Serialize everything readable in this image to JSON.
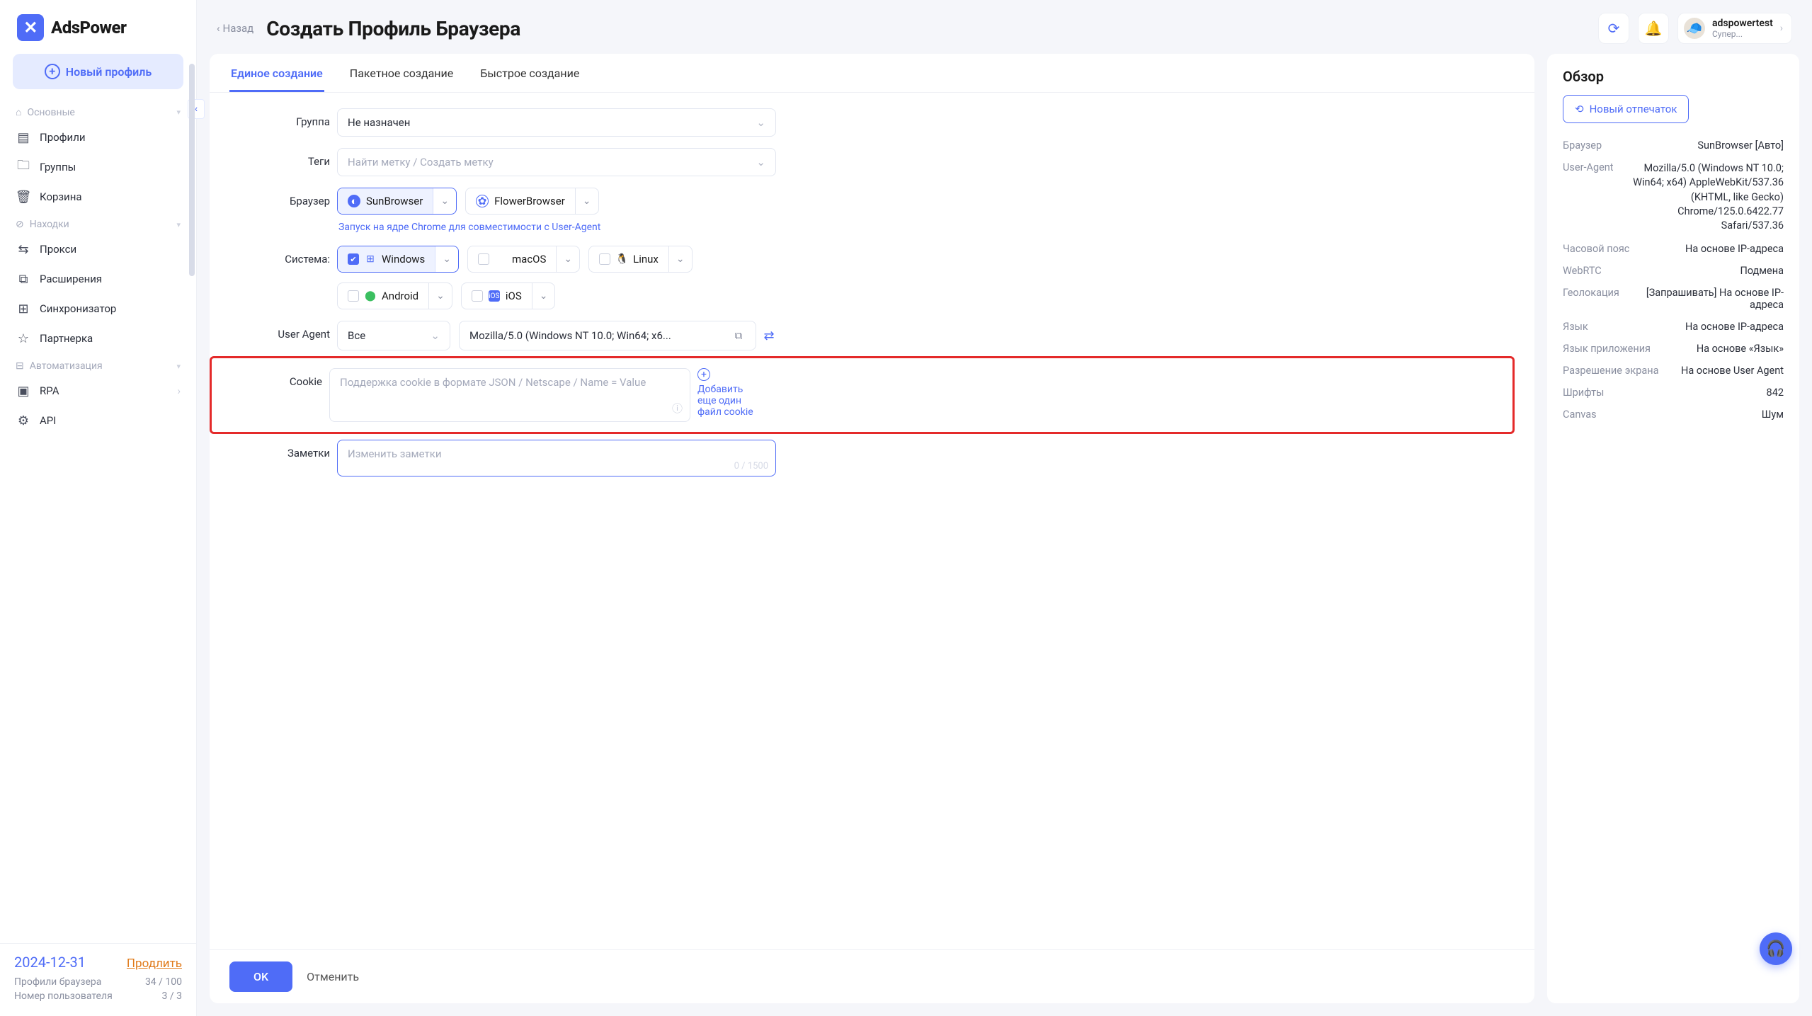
{
  "brand": "AdsPower",
  "sidebar": {
    "new_profile": "Новый профиль",
    "sections": {
      "main": "Основные",
      "findings": "Находки",
      "automation": "Автоматизация"
    },
    "items": {
      "profiles": "Профили",
      "groups": "Группы",
      "trash": "Корзина",
      "proxy": "Прокси",
      "extensions": "Расширения",
      "sync": "Синхронизатор",
      "affiliate": "Партнерка",
      "rpa": "RPA",
      "api": "API"
    },
    "footer": {
      "date": "2024-12-31",
      "extend": "Продлить",
      "stat1_label": "Профили браузера",
      "stat1_value": "34 / 100",
      "stat2_label": "Номер пользователя",
      "stat2_value": "3 / 3"
    }
  },
  "header": {
    "back": "Назад",
    "title": "Создать Профиль Браузера",
    "user_name": "adspowertest",
    "user_sub": "Супер..."
  },
  "tabs": {
    "single": "Единое создание",
    "batch": "Пакетное создание",
    "quick": "Быстрое создание"
  },
  "form": {
    "group_label": "Группа",
    "group_value": "Не назначен",
    "tags_label": "Теги",
    "tags_placeholder": "Найти метку / Создать метку",
    "browser_label": "Браузер",
    "browser_sun": "SunBrowser",
    "browser_flower": "FlowerBrowser",
    "browser_hint": "Запуск на ядре Chrome для совместимости с User-Agent",
    "system_label": "Система:",
    "os_windows": "Windows",
    "os_macos": "macOS",
    "os_linux": "Linux",
    "os_android": "Android",
    "os_ios": "iOS",
    "ua_label": "User Agent",
    "ua_select": "Все",
    "ua_value": "Mozilla/5.0 (Windows NT 10.0; Win64; x6...",
    "cookie_label": "Cookie",
    "cookie_placeholder": "Поддержка cookie в формате JSON / Netscape / Name = Value",
    "cookie_add": "Добавить еще один файл cookie",
    "notes_label": "Заметки",
    "notes_placeholder": "Изменить заметки",
    "notes_count": "0 / 1500",
    "ok": "OK",
    "cancel": "Отменить"
  },
  "summary": {
    "title": "Обзор",
    "fp_btn": "Новый отпечаток",
    "rows": {
      "browser_k": "Браузер",
      "browser_v": "SunBrowser [Авто]",
      "ua_k": "User-Agent",
      "ua_v": "Mozilla/5.0 (Windows NT 10.0; Win64; x64) AppleWebKit/537.36 (KHTML, like Gecko) Chrome/125.0.6422.77 Safari/537.36",
      "tz_k": "Часовой пояс",
      "tz_v": "На основе IP-адреса",
      "webrtc_k": "WebRTC",
      "webrtc_v": "Подмена",
      "geo_k": "Геолокация",
      "geo_v": "[Запрашивать] На основе IP-адреса",
      "lang_k": "Язык",
      "lang_v": "На основе IP-адреса",
      "applang_k": "Язык приложения",
      "applang_v": "На основе «Язык»",
      "res_k": "Разрешение экрана",
      "res_v": "На основе User Agent",
      "fonts_k": "Шрифты",
      "fonts_v": "842",
      "canvas_k": "Canvas",
      "canvas_v": "Шум"
    }
  }
}
